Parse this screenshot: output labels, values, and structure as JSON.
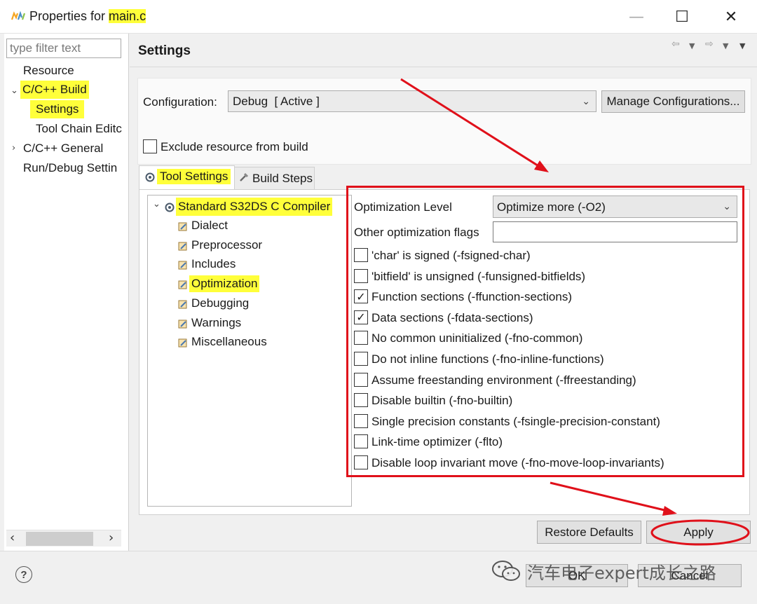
{
  "window": {
    "title_prefix": "Properties for ",
    "title_file": "main.c",
    "minimize_glyph": "—",
    "maximize_glyph": "☐",
    "close_glyph": "✕"
  },
  "filter": {
    "placeholder": "type filter text"
  },
  "nav_tree": {
    "resource": "Resource",
    "build": "C/C++ Build",
    "settings": "Settings",
    "tool_chain": "Tool Chain Editc",
    "general": "C/C++ General",
    "run_debug": "Run/Debug Settin"
  },
  "page": {
    "title": "Settings"
  },
  "configuration": {
    "label": "Configuration:",
    "value": "Debug  [ Active ]",
    "manage_button": "Manage Configurations..."
  },
  "exclude": {
    "label": "Exclude resource from build",
    "checked": false
  },
  "tabs": {
    "tool_settings": "Tool Settings",
    "build_steps": "Build Steps"
  },
  "tool_tree": {
    "compiler": "Standard S32DS C Compiler",
    "dialect": "Dialect",
    "preprocessor": "Preprocessor",
    "includes": "Includes",
    "optimization": "Optimization",
    "debugging": "Debugging",
    "warnings": "Warnings",
    "misc": "Miscellaneous"
  },
  "optimization": {
    "level_label": "Optimization Level",
    "level_value": "Optimize more (-O2)",
    "other_label": "Other optimization flags",
    "other_value": "",
    "options": [
      {
        "label": "'char' is signed (-fsigned-char)",
        "checked": false
      },
      {
        "label": "'bitfield' is unsigned (-funsigned-bitfields)",
        "checked": false
      },
      {
        "label": "Function sections (-ffunction-sections)",
        "checked": true
      },
      {
        "label": "Data sections (-fdata-sections)",
        "checked": true
      },
      {
        "label": "No common uninitialized (-fno-common)",
        "checked": false
      },
      {
        "label": "Do not inline functions (-fno-inline-functions)",
        "checked": false
      },
      {
        "label": "Assume freestanding environment (-ffreestanding)",
        "checked": false
      },
      {
        "label": "Disable builtin (-fno-builtin)",
        "checked": false
      },
      {
        "label": "Single precision constants (-fsingle-precision-constant)",
        "checked": false
      },
      {
        "label": "Link-time optimizer (-flto)",
        "checked": false
      },
      {
        "label": "Disable loop invariant move (-fno-move-loop-invariants)",
        "checked": false
      }
    ]
  },
  "buttons": {
    "restore": "Restore Defaults",
    "apply": "Apply",
    "ok": "OK",
    "cancel": "Cancel",
    "help": "?"
  },
  "watermark": "汽车电子expert成长之路",
  "colors": {
    "highlight": "#ffff3a",
    "annotation_red": "#e0101a"
  }
}
